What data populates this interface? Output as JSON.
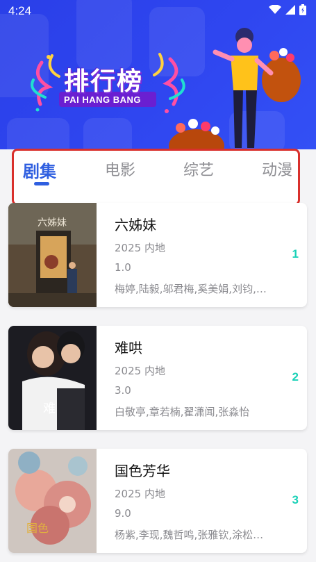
{
  "status_bar": {
    "time": "4:24"
  },
  "banner": {
    "title": "排行榜",
    "subtitle": "PAI HANG BANG"
  },
  "tabs": [
    {
      "label": "剧集",
      "active": true
    },
    {
      "label": "电影",
      "active": false
    },
    {
      "label": "综艺",
      "active": false
    },
    {
      "label": "动漫",
      "active": false
    }
  ],
  "items": [
    {
      "title": "六姊妹",
      "meta": "2025 内地",
      "score": "1.0",
      "cast": "梅婷,陆毅,邬君梅,奚美娟,刘钧,…",
      "rank": "1"
    },
    {
      "title": "难哄",
      "meta": "2025 内地",
      "score": "3.0",
      "cast": "白敬亭,章若楠,翟潇闻,张淼怡",
      "rank": "2"
    },
    {
      "title": "国色芳华",
      "meta": "2025 内地",
      "score": "9.0",
      "cast": "杨紫,李现,魏哲鸣,张雅钦,涂松…",
      "rank": "3"
    }
  ],
  "colors": {
    "accent": "#2f5fe0",
    "rank": "#19d1b7",
    "highlight_border": "#d9302c",
    "banner": "#2f46f0"
  }
}
